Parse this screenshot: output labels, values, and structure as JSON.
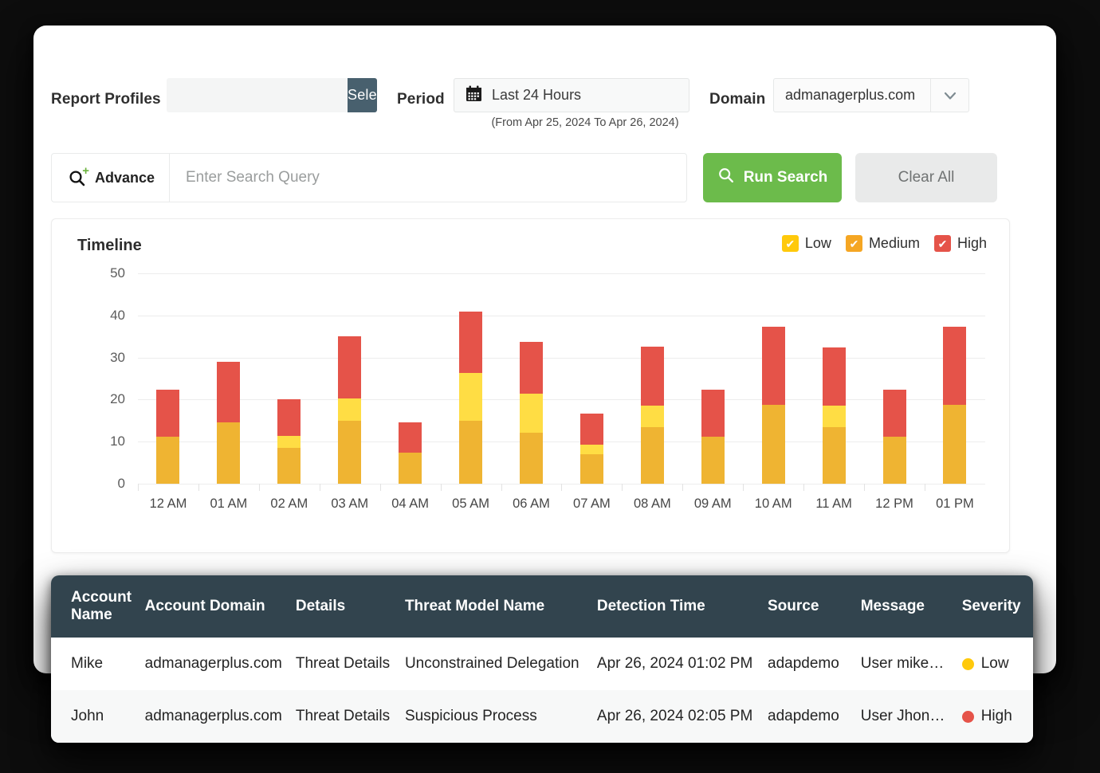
{
  "filters": {
    "report_profiles_label": "Report Profiles",
    "report_profile_value": "",
    "report_profile_placeholder": "",
    "select_button_label": "Select",
    "period_label": "Period",
    "period_value": "Last 24 Hours",
    "period_range": "(From Apr 25, 2024 To Apr 26, 2024)",
    "domain_label": "Domain",
    "domain_value": "admanagerplus.com"
  },
  "search": {
    "advance_label": "Advance",
    "query_value": "",
    "query_placeholder": "Enter Search Query",
    "run_search_label": "Run Search",
    "clear_all_label": "Clear All"
  },
  "chart_panel": {
    "title": "Timeline",
    "legend": [
      {
        "label": "Low",
        "color": "#FFC90B",
        "checked": true
      },
      {
        "label": "Medium",
        "color": "#F5A623",
        "checked": true
      },
      {
        "label": "High",
        "color": "#E55349",
        "checked": true
      }
    ]
  },
  "chart_data": {
    "type": "bar",
    "stacked": true,
    "title": "Timeline",
    "xlabel": "",
    "ylabel": "",
    "ylim": [
      0,
      50
    ],
    "yticks": [
      0,
      10,
      20,
      30,
      40,
      50
    ],
    "grid": true,
    "legend_position": "top-right",
    "categories": [
      "12 AM",
      "01 AM",
      "02 AM",
      "03 AM",
      "04 AM",
      "05 AM",
      "06 AM",
      "07 AM",
      "08 AM",
      "09 AM",
      "10 AM",
      "11 AM",
      "12 PM",
      "01 PM"
    ],
    "series": [
      {
        "name": "Medium",
        "color": "#EFB432",
        "values": [
          11.2,
          14.6,
          8.5,
          15.0,
          7.3,
          15.0,
          12.2,
          7.0,
          13.4,
          11.2,
          18.8,
          13.4,
          11.2,
          18.8
        ]
      },
      {
        "name": "Low",
        "color": "#FFDD44",
        "values": [
          0,
          0,
          2.9,
          5.3,
          0,
          11.3,
          9.3,
          2.3,
          5.2,
          0,
          0,
          5.2,
          0,
          0
        ]
      },
      {
        "name": "High",
        "color": "#E55349",
        "values": [
          11.1,
          14.4,
          8.6,
          14.7,
          7.2,
          14.7,
          12.2,
          7.3,
          13.9,
          11.2,
          18.5,
          13.8,
          11.2,
          18.5
        ]
      }
    ],
    "totals": [
      22.3,
      29.0,
      20.0,
      35.0,
      14.5,
      41.0,
      33.7,
      16.6,
      32.5,
      22.4,
      37.3,
      32.4,
      22.4,
      37.3
    ]
  },
  "results_table": {
    "columns": [
      "Account Name",
      "Account Domain",
      "Details",
      "Threat Model Name",
      "Detection Time",
      "Source",
      "Message",
      "Severity"
    ],
    "rows": [
      {
        "account_name": "Mike",
        "account_domain": "admanagerplus.com",
        "details": "Threat Details",
        "threat_model_name": "Unconstrained Delegation",
        "detection_time": "Apr 26, 2024 01:02 PM",
        "source": "adapdemo",
        "message": "User mike…",
        "severity": "Low",
        "severity_color": "#FFC90B"
      },
      {
        "account_name": "John",
        "account_domain": "admanagerplus.com",
        "details": "Threat Details",
        "threat_model_name": "Suspicious Process",
        "detection_time": "Apr 26, 2024 02:05 PM",
        "source": "adapdemo",
        "message": "User Jhon…",
        "severity": "High",
        "severity_color": "#E55349"
      }
    ]
  }
}
